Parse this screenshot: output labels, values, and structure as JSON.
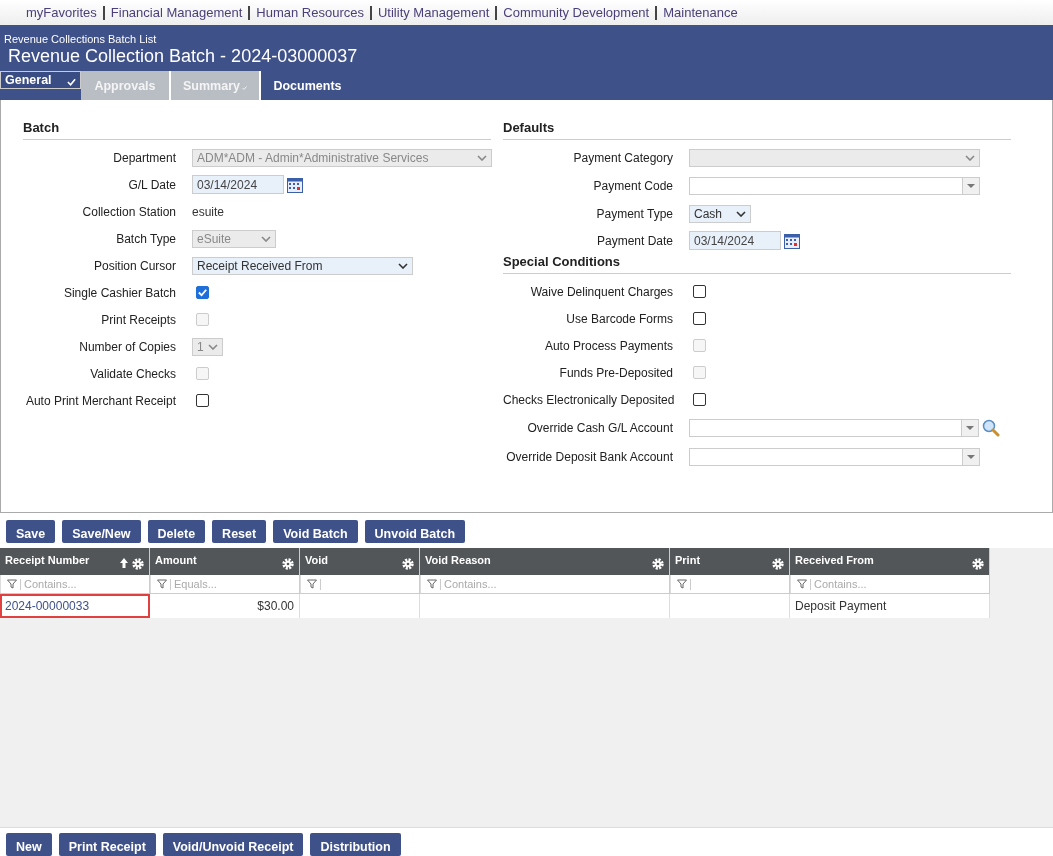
{
  "nav": [
    "myFavorites",
    "Financial Management",
    "Human Resources",
    "Utility Management",
    "Community Development",
    "Maintenance"
  ],
  "header": {
    "breadcrumb": "Revenue Collections Batch List",
    "title": "Revenue Collection Batch - 2024-03000037"
  },
  "tabs": [
    {
      "label": "General",
      "selected": true,
      "checked": true,
      "disabled": false
    },
    {
      "label": "Approvals",
      "selected": false,
      "checked": false,
      "disabled": true
    },
    {
      "label": "Summary",
      "selected": false,
      "checked": true,
      "disabled": true
    },
    {
      "label": "Documents",
      "selected": false,
      "checked": false,
      "disabled": false
    }
  ],
  "batch": {
    "title": "Batch",
    "fields": [
      {
        "label": "Department",
        "kind": "select",
        "value": "ADM*ADM - Admin*Administrative Services",
        "disabled": true
      },
      {
        "label": "G/L Date",
        "kind": "date",
        "value": "03/14/2024",
        "disabled": false
      },
      {
        "label": "Collection Station",
        "kind": "text",
        "value": "esuite"
      },
      {
        "label": "Batch Type",
        "kind": "select",
        "value": "eSuite",
        "disabled": true
      },
      {
        "label": "Position Cursor",
        "kind": "select",
        "value": "Receipt Received From",
        "disabled": false
      },
      {
        "label": "Single Cashier Batch",
        "kind": "checkbox",
        "checked": true,
        "disabled": false
      },
      {
        "label": "Print Receipts",
        "kind": "checkbox",
        "checked": false,
        "disabled": true
      },
      {
        "label": "Number of Copies",
        "kind": "select",
        "value": "1",
        "disabled": true
      },
      {
        "label": "Validate Checks",
        "kind": "checkbox",
        "checked": false,
        "disabled": true
      },
      {
        "label": "Auto Print Merchant Receipt",
        "kind": "checkbox",
        "checked": false,
        "disabled": false
      }
    ]
  },
  "defaults": {
    "title": "Defaults",
    "fields": [
      {
        "label": "Payment Category",
        "kind": "select",
        "disabled": true
      },
      {
        "label": "Payment Code",
        "kind": "combo",
        "disabled": false
      },
      {
        "label": "Payment Type",
        "kind": "select",
        "value": "Cash",
        "disabled": false
      },
      {
        "label": "Payment Date",
        "kind": "date",
        "value": "03/14/2024",
        "disabled": false
      }
    ]
  },
  "special_conditions": {
    "title": "Special Conditions",
    "fields": [
      {
        "label": "Waive Delinquent Charges",
        "kind": "checkbox",
        "checked": false,
        "disabled": false
      },
      {
        "label": "Use Barcode Forms",
        "kind": "checkbox",
        "checked": false,
        "disabled": false
      },
      {
        "label": "Auto Process Payments",
        "kind": "checkbox",
        "checked": false,
        "disabled": true
      },
      {
        "label": "Funds Pre-Deposited",
        "kind": "checkbox",
        "checked": false,
        "disabled": true
      },
      {
        "label": "Checks Electronically Deposited",
        "kind": "checkbox",
        "checked": false,
        "disabled": false
      },
      {
        "label": "Override Cash G/L Account",
        "kind": "lookup",
        "disabled": false
      },
      {
        "label": "Override Deposit Bank Account",
        "kind": "combo",
        "disabled": false
      }
    ]
  },
  "batch_buttons": [
    "Save",
    "Save/New",
    "Delete",
    "Reset",
    "Void Batch",
    "Unvoid Batch"
  ],
  "grid": {
    "columns": [
      {
        "label": "Receipt Number",
        "sorted": true,
        "placeholder": "Contains..."
      },
      {
        "label": "Amount",
        "sorted": false,
        "placeholder": "Equals..."
      },
      {
        "label": "Void",
        "sorted": false
      },
      {
        "label": "Void Reason",
        "sorted": false,
        "placeholder": "Contains..."
      },
      {
        "label": "Print",
        "sorted": false
      },
      {
        "label": "Received From",
        "sorted": false,
        "placeholder": "Contains..."
      }
    ],
    "rows": [
      {
        "highlighted": true,
        "cells": [
          "2024-00000033",
          "$30.00",
          "",
          "",
          "",
          "Deposit Payment"
        ]
      }
    ]
  },
  "receipt_buttons": [
    "New",
    "Print Receipt",
    "Void/Unvoid Receipt",
    "Distribution"
  ]
}
